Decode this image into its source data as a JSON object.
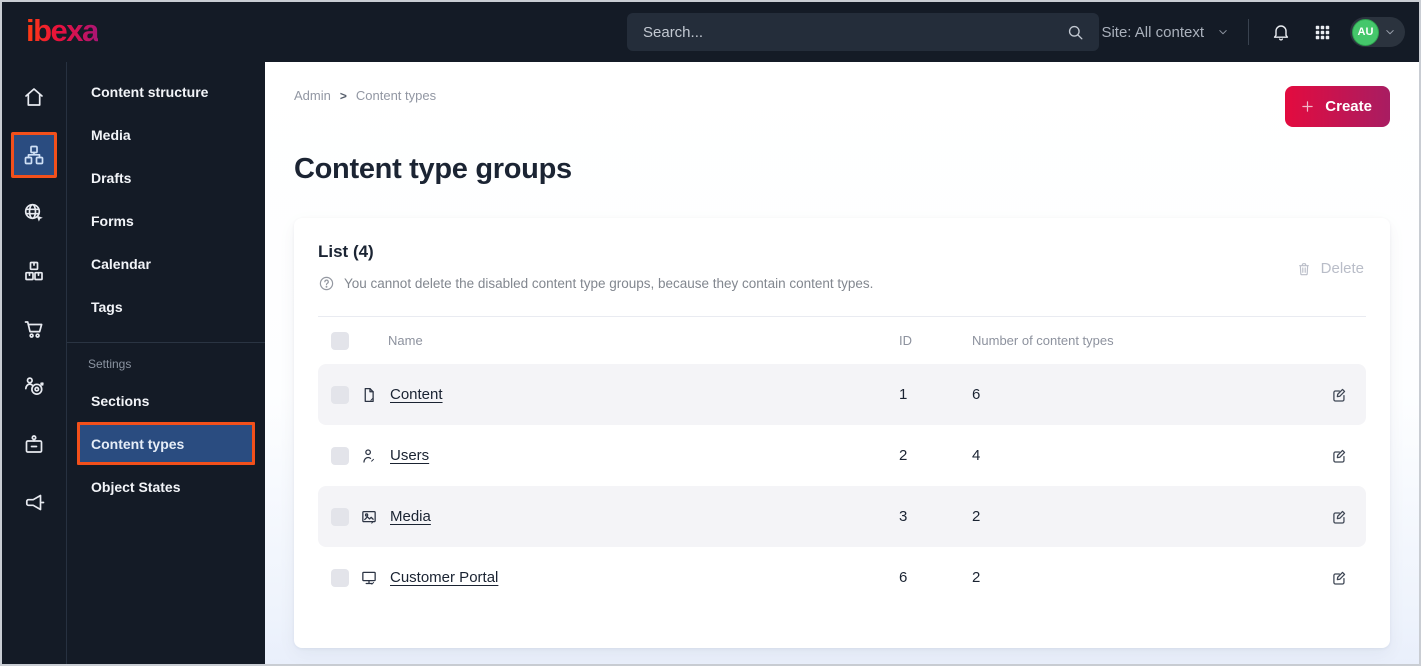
{
  "colors": {
    "dark_bg": "#141b26",
    "active_blue": "#2a4c80",
    "highlight_orange": "#f2501b",
    "brand_gradient_start": "#e30b3f",
    "brand_gradient_end": "#a81d62",
    "avatar_green": "#45c76b"
  },
  "topbar": {
    "logo_text": "ibexa",
    "search_placeholder": "Search...",
    "site_context_label": "Site: All context",
    "avatar_initials": "AU"
  },
  "sidebar": {
    "rail_items": [
      {
        "name": "dashboard",
        "icon": "home-icon",
        "active": false
      },
      {
        "name": "content-structure",
        "icon": "sitemap-icon",
        "active": true
      },
      {
        "name": "site",
        "icon": "globe-cursor-icon",
        "active": false
      },
      {
        "name": "products",
        "icon": "boxes-icon",
        "active": false
      },
      {
        "name": "commerce",
        "icon": "cart-icon",
        "active": false
      },
      {
        "name": "personalization",
        "icon": "person-target-icon",
        "active": false
      },
      {
        "name": "admin",
        "icon": "badge-icon",
        "active": false
      },
      {
        "name": "campaigns",
        "icon": "megaphone-icon",
        "active": false
      }
    ],
    "menu_items": [
      {
        "label": "Content structure",
        "active": false
      },
      {
        "label": "Media",
        "active": false
      },
      {
        "label": "Drafts",
        "active": false
      },
      {
        "label": "Forms",
        "active": false
      },
      {
        "label": "Calendar",
        "active": false
      },
      {
        "label": "Tags",
        "active": false
      }
    ],
    "settings_label": "Settings",
    "settings_items": [
      {
        "label": "Sections",
        "active": false
      },
      {
        "label": "Content types",
        "active": true
      },
      {
        "label": "Object States",
        "active": false
      }
    ]
  },
  "main": {
    "breadcrumb": [
      "Admin",
      "Content types"
    ],
    "create_label": "Create",
    "page_title": "Content type groups",
    "card": {
      "list_title": "List (4)",
      "info_text": "You cannot delete the disabled content type groups, because they contain content types.",
      "delete_label": "Delete",
      "table": {
        "headers": {
          "name": "Name",
          "id": "ID",
          "count": "Number of content types"
        },
        "rows": [
          {
            "name": "Content",
            "id": "1",
            "count": "6",
            "icon": "file-edit-icon"
          },
          {
            "name": "Users",
            "id": "2",
            "count": "4",
            "icon": "user-edit-icon"
          },
          {
            "name": "Media",
            "id": "3",
            "count": "2",
            "icon": "image-edit-icon"
          },
          {
            "name": "Customer Portal",
            "id": "6",
            "count": "2",
            "icon": "monitor-edit-icon"
          }
        ]
      }
    }
  }
}
